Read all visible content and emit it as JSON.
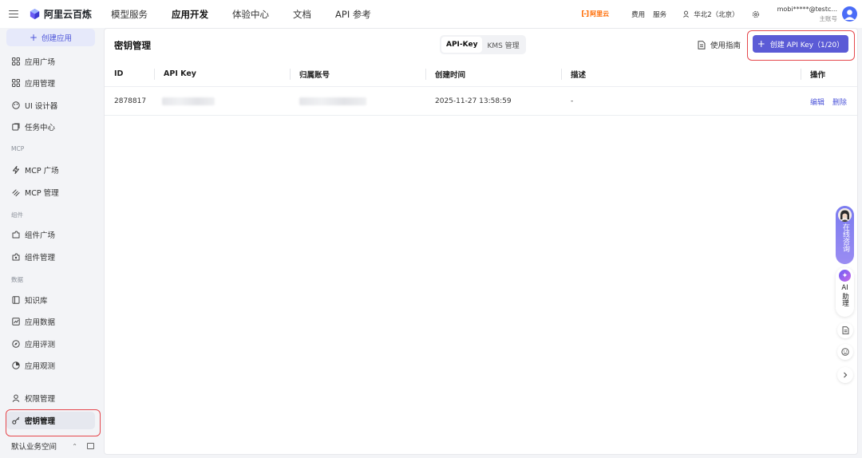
{
  "topbar": {
    "brand": "阿里云百炼",
    "nav": [
      "模型服务",
      "应用开发",
      "体验中心",
      "文档",
      "API 参考"
    ],
    "nav_active_index": 1,
    "aliyun_label": "阿里云",
    "links": [
      "费用",
      "服务"
    ],
    "region": "华北2（北京）",
    "account_name": "mobi*****@testc...",
    "account_role": "主账号"
  },
  "sidebar": {
    "create_app": "创建应用",
    "items": [
      {
        "label": "应用广场",
        "icon": "grid-icon"
      },
      {
        "label": "应用管理",
        "icon": "grid-icon"
      },
      {
        "label": "UI 设计器",
        "icon": "palette-icon"
      },
      {
        "label": "任务中心",
        "icon": "task-icon"
      },
      {
        "label": "MCP 广场",
        "icon": "lightning-icon"
      },
      {
        "label": "MCP 管理",
        "icon": "mcp-icon"
      },
      {
        "label": "组件广场",
        "icon": "component-icon"
      },
      {
        "label": "组件管理",
        "icon": "component-settings-icon"
      },
      {
        "label": "知识库",
        "icon": "book-icon"
      },
      {
        "label": "应用数据",
        "icon": "chart-icon"
      },
      {
        "label": "应用评测",
        "icon": "compass-icon"
      },
      {
        "label": "应用观测",
        "icon": "pie-icon"
      },
      {
        "label": "权限管理",
        "icon": "user-icon"
      },
      {
        "label": "密钥管理",
        "icon": "key-icon"
      }
    ],
    "groups": [
      "MCP",
      "组件",
      "数据"
    ],
    "workspace": "默认业务空间"
  },
  "main": {
    "title": "密钥管理",
    "tabs": [
      "API-Key",
      "KMS 管理"
    ],
    "active_tab": 0,
    "guide": "使用指南",
    "create_button": "创建 API Key（1/20）",
    "columns": [
      "ID",
      "API Key",
      "归属账号",
      "创建时间",
      "描述",
      "操作"
    ],
    "rows": [
      {
        "id": "2878817",
        "created": "2025-11-27 13:58:59",
        "description": "-",
        "actions": [
          "编辑",
          "删除"
        ]
      }
    ]
  },
  "floating": {
    "consult": "在线咨询",
    "ai_label": "AI",
    "ai_text": "助理"
  },
  "colors": {
    "accent": "#5b5bd6",
    "highlight": "#e5484d",
    "aliyun": "#ff6a00"
  }
}
